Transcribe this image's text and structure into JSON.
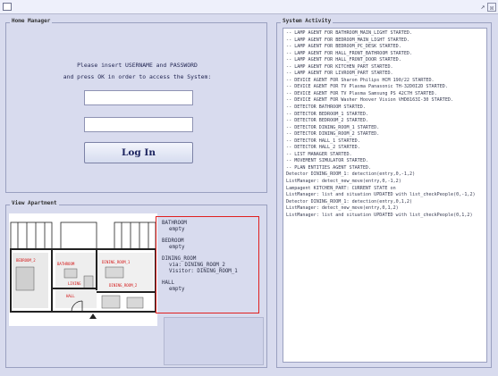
{
  "window": {
    "maximize_glyph": "↗",
    "close_glyph": "☒"
  },
  "home_manager": {
    "legend": "Home Manager",
    "prompt_line1": "Please insert USERNAME and PASSWORD",
    "prompt_line2": "and press OK in order to access the System:",
    "username_value": "",
    "password_value": "",
    "login_label": "Log In"
  },
  "view_apartment": {
    "legend": "View Apartment",
    "floorplan_labels": {
      "bedroom_2": "BEDROOM_2",
      "bathroom": "BATHROOM",
      "dining_room_1": "DINING_ROOM_1",
      "living": "LIVING",
      "dining_room_2": "DINING_ROOM_2",
      "hall": "HALL"
    },
    "rooms": [
      {
        "name": "BATHROOM",
        "status": [
          "empty"
        ]
      },
      {
        "name": "BEDROOM",
        "status": [
          "empty"
        ]
      },
      {
        "name": "DINING_ROOM",
        "status": [
          "via: DINING_ROOM_2",
          "Visitor: DINING_ROOM_1"
        ]
      },
      {
        "name": "HALL",
        "status": [
          "empty"
        ]
      }
    ]
  },
  "system_activity": {
    "legend": "System Activity",
    "log": [
      "-- LAMP AGENT FOR BATHROOM_MAIN_LIGHT STARTED.",
      "-- LAMP AGENT FOR BEDROOM_MAIN_LIGHT STARTED.",
      "-- LAMP AGENT FOR BEDROOM_PC_DESK STARTED.",
      "-- LAMP AGENT FOR HALL_FRONT_BATHROOM STARTED.",
      "-- LAMP AGENT FOR HALL_FRONT_DOOR STARTED.",
      "-- LAMP AGENT FOR KITCHEN_PART STARTED.",
      "-- LAMP AGENT FOR LIVROOM_PART STARTED.",
      "-- DEVICE AGENT FOR Sharon Philips HCM 190/22 STARTED.",
      "-- DEVICE AGENT FOR TV Plasma Panasonic TH-32D0I2D STARTED.",
      "-- DEVICE AGENT FOR TV Plasma Samsung PS 42C7H STARTED.",
      "-- DEVICE AGENT FOR Washer Hoover Vision VHD8163I-30 STARTED.",
      "-- DETECTOR BATHROOM STARTED.",
      "-- DETECTOR BEDROOM_1 STARTED.",
      "-- DETECTOR BEDROOM_2 STARTED.",
      "-- DETECTOR DINING_ROOM_1 STARTED.",
      "-- DETECTOR DINING_ROOM_2 STARTED.",
      "-- DETECTOR HALL_1 STARTED.",
      "-- DETECTOR HALL_2 STARTED.",
      "-- LIST MANAGER STARTED.",
      "-- MOVEMENT SIMULATOR STARTED.",
      "-- PLAN ENTITIES AGENT STARTED.",
      "Detector DINING_ROOM_1: detection(entry,0,-1,2)",
      "ListManager: detect_new_move(entry,0,-1,2)",
      "Lampagent KITCHEN_PART: CURRENT STATE on",
      "ListManager: list and situation UPDATED with list_checkPeople(0,-1,2)",
      "Detector DINING_ROOM_1: detection(entry,0,1,2)",
      "ListManager: detect_new_move(entry,0,1,2)",
      "ListManager: list and situation UPDATED with list_checkPeople(0,1,2)"
    ]
  }
}
